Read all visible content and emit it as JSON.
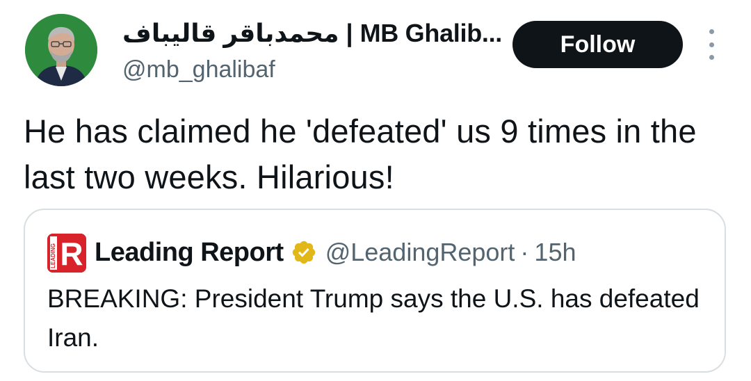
{
  "tweet": {
    "author": {
      "display_name": "محمدباقر قالیباف | MB Ghalib...",
      "handle": "@mb_ghalibaf",
      "avatar_icon": "profile-photo"
    },
    "follow_label": "Follow",
    "more_icon": "more-vertical-icon",
    "text": "He has claimed he 'defeated' us 9 times in the last two weeks. Hilarious!"
  },
  "quoted_tweet": {
    "logo_letter": "R",
    "logo_side_text": "LEADING",
    "name": "Leading Report",
    "verified_icon": "verified-badge-icon",
    "handle": "@LeadingReport",
    "separator": "·",
    "time": "15h",
    "text": "BREAKING: President Trump says the U.S. has defeated Iran."
  },
  "colors": {
    "text_primary": "#0f1419",
    "text_secondary": "#536471",
    "follow_bg": "#0f1419",
    "border": "#d9dee2",
    "logo_red": "#d8232a",
    "verified_gold": "#e2b719"
  }
}
